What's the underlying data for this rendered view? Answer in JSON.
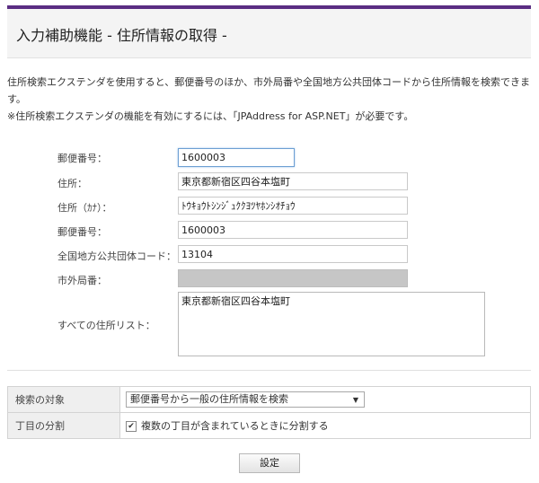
{
  "header": {
    "title": "入力補助機能 - 住所情報の取得 -"
  },
  "description": {
    "line1": "住所検索エクステンダを使用すると、郵便番号のほか、市外局番や全国地方公共団体コードから住所情報を検索できま",
    "line2": "す。",
    "line3": "※住所検索エクステンダの機能を有効にするには、「JPAddress for ASP.NET」が必要です。"
  },
  "form": {
    "postal_input_label": "郵便番号：",
    "postal_input_value": "1600003",
    "address_label": "住所：",
    "address_value": "東京都新宿区四谷本塩町",
    "kana_label": "住所（ｶﾅ）：",
    "kana_value": "ﾄｳｷｮｳﾄｼﾝｼﾞｭｸｸﾖﾂﾔﾎﾝｼｵﾁｮｳ",
    "postal_result_label": "郵便番号：",
    "postal_result_value": "1600003",
    "municipal_code_label": "全国地方公共団体コード：",
    "municipal_code_value": "13104",
    "area_code_label": "市外局番：",
    "area_code_value": "",
    "address_list_label": "すべての住所リスト：",
    "address_list_value": "東京都新宿区四谷本塩町"
  },
  "options": {
    "search_target_label": "検索の対象",
    "search_target_value": "郵便番号から一般の住所情報を検索",
    "split_label": "丁目の分割",
    "split_checkbox_label": "複数の丁目が含まれているときに分割する",
    "split_checked": true
  },
  "buttons": {
    "settings_label": "設定"
  },
  "colors": {
    "accent": "#5a2d82",
    "focus_border": "#6d9fd3",
    "disabled_bg": "#c6c6c6"
  }
}
